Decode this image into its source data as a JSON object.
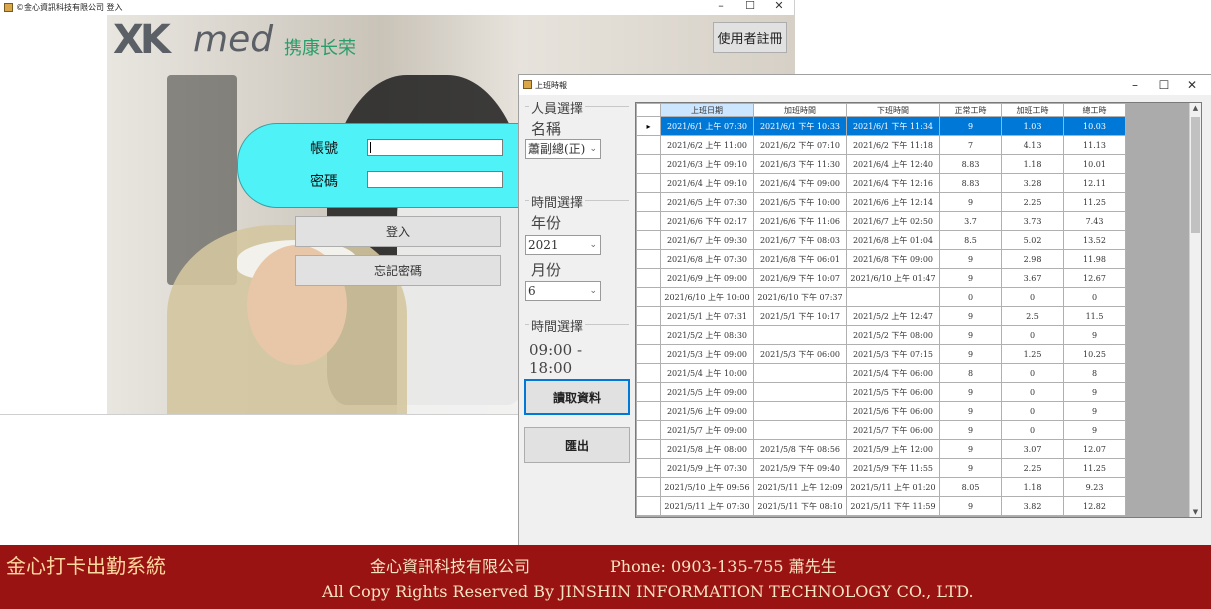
{
  "login_window": {
    "title": "©金心資訊科技有限公司 登入",
    "logo": {
      "mark": "XK",
      "brand": "med",
      "cn": "携康长荣"
    },
    "register_label": "使用者註冊",
    "account_label": "帳號",
    "password_label": "密碼",
    "login_label": "登入",
    "forgot_label": "忘記密碼",
    "controls": {
      "minimize": "–",
      "maximize": "☐",
      "close": "✕"
    }
  },
  "attendance_window": {
    "title": "上班時報",
    "controls": {
      "minimize": "–",
      "maximize": "☐",
      "close": "✕"
    },
    "person_group": {
      "title": "人員選擇",
      "name_label": "名稱",
      "name_value": "蕭副總(正)"
    },
    "time_group": {
      "title": "時間選擇",
      "year_label": "年份",
      "year_value": "2021",
      "month_label": "月份",
      "month_value": "6"
    },
    "shift_group": {
      "title": "時間選擇",
      "shift": "09:00 - 18:00"
    },
    "read_button": "讀取資料",
    "export_button": "匯出",
    "grid": {
      "columns": [
        "上班日期",
        "加班時間",
        "下班時間",
        "正常工時",
        "加班工時",
        "總工時"
      ],
      "rows": [
        [
          "2021/6/1 上午 07:30",
          "2021/6/1 下午 10:33",
          "2021/6/1 下午 11:34",
          "9",
          "1.03",
          "10.03"
        ],
        [
          "2021/6/2 上午 11:00",
          "2021/6/2 下午 07:10",
          "2021/6/2 下午 11:18",
          "7",
          "4.13",
          "11.13"
        ],
        [
          "2021/6/3 上午 09:10",
          "2021/6/3 下午 11:30",
          "2021/6/4 上午 12:40",
          "8.83",
          "1.18",
          "10.01"
        ],
        [
          "2021/6/4 上午 09:10",
          "2021/6/4 下午 09:00",
          "2021/6/4 下午 12:16",
          "8.83",
          "3.28",
          "12.11"
        ],
        [
          "2021/6/5 上午 07:30",
          "2021/6/5 下午 10:00",
          "2021/6/6 上午 12:14",
          "9",
          "2.25",
          "11.25"
        ],
        [
          "2021/6/6 下午 02:17",
          "2021/6/6 下午 11:06",
          "2021/6/7 上午 02:50",
          "3.7",
          "3.73",
          "7.43"
        ],
        [
          "2021/6/7 上午 09:30",
          "2021/6/7 下午 08:03",
          "2021/6/8 上午 01:04",
          "8.5",
          "5.02",
          "13.52"
        ],
        [
          "2021/6/8 上午 07:30",
          "2021/6/8 下午 06:01",
          "2021/6/8 下午 09:00",
          "9",
          "2.98",
          "11.98"
        ],
        [
          "2021/6/9 上午 09:00",
          "2021/6/9 下午 10:07",
          "2021/6/10 上午 01:47",
          "9",
          "3.67",
          "12.67"
        ],
        [
          "2021/6/10 上午 10:00",
          "2021/6/10 下午 07:37",
          "",
          "0",
          "0",
          "0"
        ],
        [
          "2021/5/1 上午 07:31",
          "2021/5/1 下午 10:17",
          "2021/5/2 上午 12:47",
          "9",
          "2.5",
          "11.5"
        ],
        [
          "2021/5/2 上午 08:30",
          "",
          "2021/5/2 下午 08:00",
          "9",
          "0",
          "9"
        ],
        [
          "2021/5/3 上午 09:00",
          "2021/5/3 下午 06:00",
          "2021/5/3 下午 07:15",
          "9",
          "1.25",
          "10.25"
        ],
        [
          "2021/5/4 上午 10:00",
          "",
          "2021/5/4 下午 06:00",
          "8",
          "0",
          "8"
        ],
        [
          "2021/5/5 上午 09:00",
          "",
          "2021/5/5 下午 06:00",
          "9",
          "0",
          "9"
        ],
        [
          "2021/5/6 上午 09:00",
          "",
          "2021/5/6 下午 06:00",
          "9",
          "0",
          "9"
        ],
        [
          "2021/5/7 上午 09:00",
          "",
          "2021/5/7 下午 06:00",
          "9",
          "0",
          "9"
        ],
        [
          "2021/5/8 上午 08:00",
          "2021/5/8 下午 08:56",
          "2021/5/9 上午 12:00",
          "9",
          "3.07",
          "12.07"
        ],
        [
          "2021/5/9 上午 07:30",
          "2021/5/9 下午 09:40",
          "2021/5/9 下午 11:55",
          "9",
          "2.25",
          "11.25"
        ],
        [
          "2021/5/10 上午 09:56",
          "2021/5/11 上午 12:09",
          "2021/5/11 上午 01:20",
          "8.05",
          "1.18",
          "9.23"
        ],
        [
          "2021/5/11 上午 07:30",
          "2021/5/11 下午 08:10",
          "2021/5/11 下午 11:59",
          "9",
          "3.82",
          "12.82"
        ]
      ]
    }
  },
  "footer": {
    "system_name": "金心打卡出勤系統",
    "company": "金心資訊科技有限公司",
    "phone": "Phone:  0903-135-755    蕭先生",
    "copyright": "All Copy Rights Reserved By JINSHIN INFORMATION TECHNOLOGY CO., LTD."
  },
  "colors": {
    "login_panel": "#4ff2f7",
    "footer_bg": "#9a1313",
    "selection": "#0078d7"
  }
}
